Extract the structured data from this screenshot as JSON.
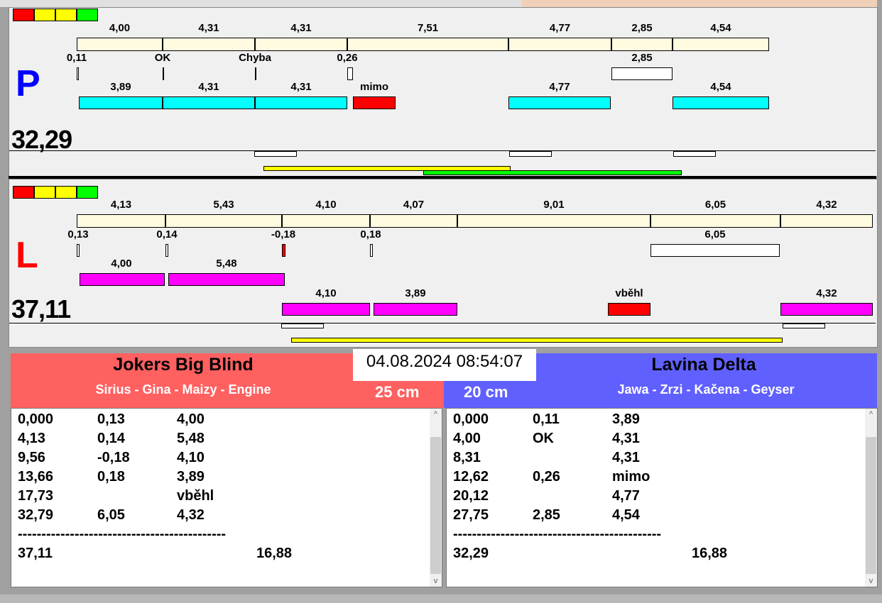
{
  "colors": {
    "beige": "#fffbe0",
    "cyan": "#00ffff",
    "magenta": "#ff00ff",
    "red": "#ff0000",
    "yellow": "#ffff00",
    "green": "#00ff00",
    "team_left": "#ff6060",
    "team_right": "#6060ff"
  },
  "lane_p": {
    "lane": "P",
    "total": "32,29",
    "row1": [
      "4,00",
      "4,31",
      "4,31",
      "7,51",
      "4,77",
      "2,85",
      "4,54"
    ],
    "row2": [
      "0,11",
      "OK",
      "Chyba",
      "0,26",
      "2,85"
    ],
    "row3": [
      "3,89",
      "4,31",
      "4,31",
      "mimo",
      "4,77",
      "4,54"
    ]
  },
  "lane_l": {
    "lane": "L",
    "total": "37,11",
    "row1": [
      "4,13",
      "5,43",
      "4,10",
      "4,07",
      "9,01",
      "6,05",
      "4,32"
    ],
    "row2": [
      "0,13",
      "0,14",
      "-0,18",
      "0,18",
      "6,05"
    ],
    "row3": [
      "4,00",
      "5,48"
    ],
    "row4": [
      "4,10",
      "3,89",
      "vběhl",
      "4,32"
    ]
  },
  "datetime": "04.08.2024 08:54:07",
  "left_team": {
    "name": "Jokers Big Blind",
    "dogs": "Sirius - Gina - Maizy - Engine",
    "height": "25 cm",
    "rows": [
      [
        "0,000",
        "0,13",
        "4,00"
      ],
      [
        "4,13",
        "0,14",
        "5,48"
      ],
      [
        "9,56",
        "-0,18",
        "4,10"
      ],
      [
        "13,66",
        "0,18",
        "3,89"
      ],
      [
        "17,73",
        "",
        "vběhl"
      ],
      [
        "32,79",
        "6,05",
        "4,32"
      ]
    ],
    "separator": "--------------------------------------------",
    "total": "37,11",
    "diff": "16,88"
  },
  "right_team": {
    "name": "Lavina Delta",
    "dogs": "Jawa - Zrzi - Kačena - Geyser",
    "height": "20 cm",
    "rows": [
      [
        "0,000",
        "0,11",
        "3,89"
      ],
      [
        "4,00",
        "OK",
        "4,31"
      ],
      [
        "8,31",
        "",
        "4,31"
      ],
      [
        "12,62",
        "0,26",
        "mimo"
      ],
      [
        "20,12",
        "",
        "4,77"
      ],
      [
        "27,75",
        "2,85",
        "4,54"
      ]
    ],
    "separator": "--------------------------------------------",
    "total": "32,29",
    "diff": "16,88"
  }
}
